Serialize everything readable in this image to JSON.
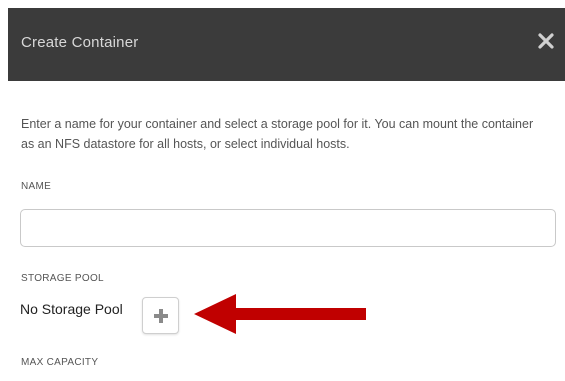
{
  "dialog": {
    "title": "Create Container",
    "close_icon": "close-icon",
    "description": "Enter a name for your container and select a storage pool for it. You can mount the container as an NFS datastore for all hosts, or select individual hosts."
  },
  "fields": {
    "name_label": "NAME",
    "name_value": "",
    "storage_pool_label": "STORAGE POOL",
    "storage_pool_value": "No Storage Pool",
    "add_icon": "plus-icon",
    "max_capacity_label": "MAX CAPACITY"
  },
  "annotation": {
    "arrow_icon": "left-arrow-icon",
    "arrow_color": "#c00000"
  },
  "colors": {
    "header_bg": "#3b3b3b",
    "header_text": "#d8d8d8"
  }
}
